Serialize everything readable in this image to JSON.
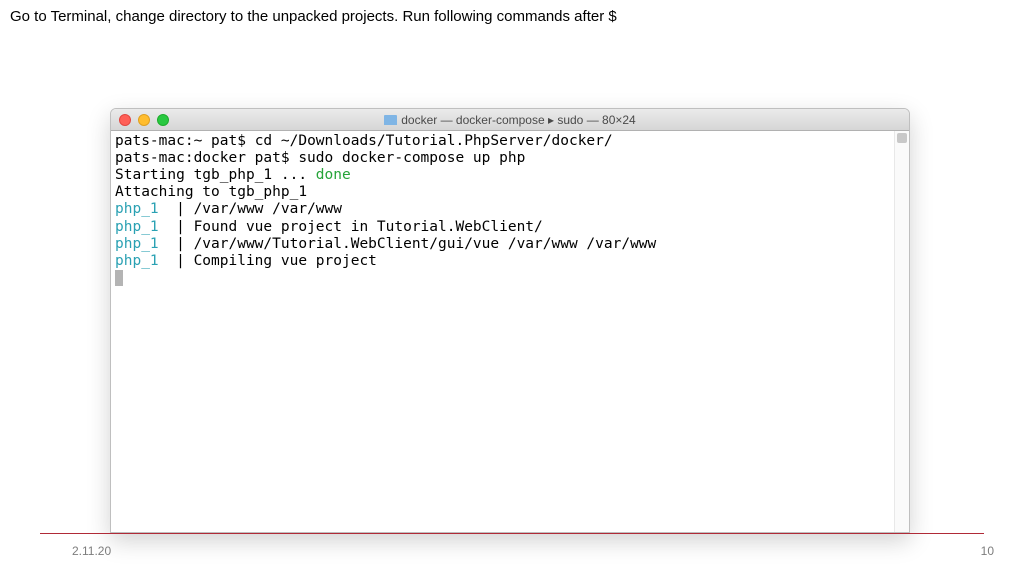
{
  "instruction": "Go to Terminal, change directory to the unpacked projects. Run following commands after $",
  "window": {
    "title": "docker — docker-compose ▸ sudo — 80×24"
  },
  "terminal": {
    "line1_prompt": "pats-mac:~ pat$ ",
    "line1_cmd": "cd ~/Downloads/Tutorial.PhpServer/docker/",
    "line2_prompt": "pats-mac:docker pat$ ",
    "line2_cmd": "sudo docker-compose up php",
    "line3_a": "Starting tgb_php_1 ... ",
    "line3_b": "done",
    "line4": "Attaching to tgb_php_1",
    "svc": "php_1",
    "sep": "  | ",
    "log1": "/var/www /var/www",
    "log2": "Found vue project in Tutorial.WebClient/",
    "log3": "/var/www/Tutorial.WebClient/gui/vue /var/www /var/www",
    "log4": "Compiling vue project"
  },
  "footer": {
    "date": "2.11.20",
    "page": "10"
  }
}
